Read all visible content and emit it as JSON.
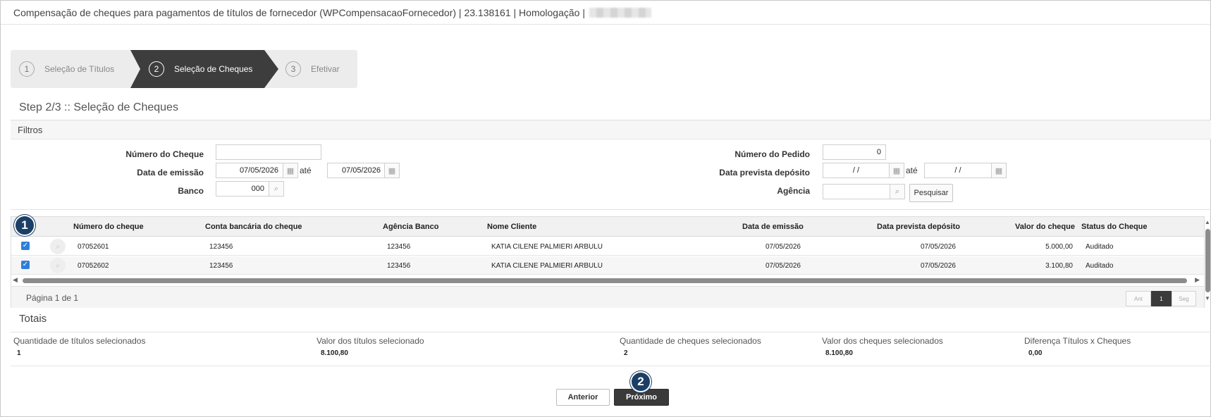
{
  "window": {
    "title": "Compensação de cheques para pagamentos de títulos de fornecedor (WPCompensacaoFornecedor) | 23.138161 | Homologação |"
  },
  "wizard": {
    "steps": [
      {
        "num": "1",
        "label": "Seleção de Títulos"
      },
      {
        "num": "2",
        "label": "Seleção de Cheques"
      },
      {
        "num": "3",
        "label": "Efetivar"
      }
    ],
    "active_step": 2
  },
  "step_title": "Step 2/3 :: Seleção de Cheques",
  "filters": {
    "header": "Filtros",
    "numero_cheque_label": "Número do Cheque",
    "numero_cheque_value": "",
    "data_emissao_label": "Data de emissão",
    "data_emissao_de": "07/05/2026",
    "ate_label": "até",
    "data_emissao_ate": "07/05/2026",
    "banco_label": "Banco",
    "banco_value": "000",
    "numero_pedido_label": "Número do Pedido",
    "numero_pedido_value": "0",
    "data_prevista_label": "Data prevista depósito",
    "data_prevista_de": "/ /",
    "data_prevista_ate": "/ /",
    "agencia_label": "Agência",
    "agencia_value": "",
    "pesquisar_label": "Pesquisar"
  },
  "grid": {
    "columns": [
      "Número do cheque",
      "Conta bancária do cheque",
      "Agência Banco",
      "Nome Cliente",
      "Data de emissão",
      "Data prevista depósito",
      "Valor do cheque",
      "Status do Cheque"
    ],
    "rows": [
      {
        "checked": true,
        "numero": "07052601",
        "conta": "123456",
        "agencia": "123456",
        "cliente": "KATIA CILENE PALMIERI ARBULU",
        "emissao": "07/05/2026",
        "prevista": "07/05/2026",
        "valor": "5.000,00",
        "status": "Auditado"
      },
      {
        "checked": true,
        "numero": "07052602",
        "conta": "123456",
        "agencia": "123456",
        "cliente": "KATIA CILENE PALMIERI ARBULU",
        "emissao": "07/05/2026",
        "prevista": "07/05/2026",
        "valor": "3.100,80",
        "status": "Auditado"
      }
    ],
    "pager_text": "Página 1 de 1",
    "pager": {
      "prev": "Ant",
      "current": "1",
      "next": "Seg"
    }
  },
  "badges": {
    "one": "1",
    "two": "2"
  },
  "totais": {
    "title": "Totais",
    "items": [
      {
        "label": "Quantidade de títulos selecionados",
        "value": "1"
      },
      {
        "label": "Valor dos títulos selecionado",
        "value": "8.100,80"
      },
      {
        "label": "Quantidade de cheques selecionados",
        "value": "2"
      },
      {
        "label": "Valor dos cheques selecionados",
        "value": "8.100,80"
      },
      {
        "label": "Diferença Títulos x Cheques",
        "value": "0,00"
      }
    ]
  },
  "actions": {
    "anterior": "Anterior",
    "proximo": "Próximo"
  },
  "icons": {
    "calendar": "calendar-icon",
    "search": "search-icon",
    "check": "checkbox-checked-icon"
  },
  "colors": {
    "active_step": "#3d3d3d",
    "badge": "#1b3f66",
    "checkbox": "#2f7fd9",
    "primary_button": "#3a3a3a"
  }
}
